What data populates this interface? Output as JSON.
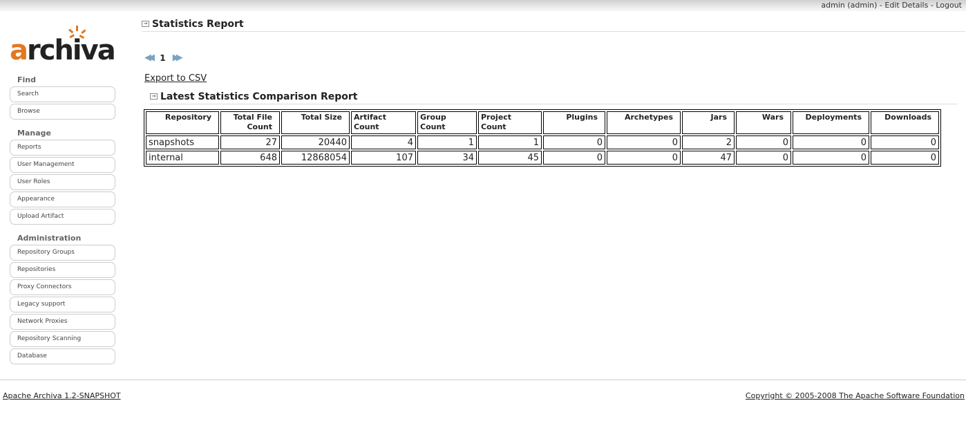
{
  "header": {
    "username": "admin",
    "role": "(admin)",
    "edit_details": "Edit Details",
    "logout": "Logout",
    "separator": "-"
  },
  "logo": {
    "first": "a",
    "rest": "rchiva"
  },
  "nav": {
    "find": {
      "heading": "Find",
      "items": [
        "Search",
        "Browse"
      ]
    },
    "manage": {
      "heading": "Manage",
      "items": [
        "Reports",
        "User Management",
        "User Roles",
        "Appearance",
        "Upload Artifact"
      ]
    },
    "admin": {
      "heading": "Administration",
      "items": [
        "Repository Groups",
        "Repositories",
        "Proxy Connectors",
        "Legacy support",
        "Network Proxies",
        "Repository Scanning",
        "Database"
      ]
    }
  },
  "main": {
    "title": "Statistics Report",
    "page_number": "1",
    "export_label": "Export to CSV",
    "comparison_title": "Latest Statistics Comparison Report"
  },
  "table": {
    "headers": [
      "Repository",
      "Total File Count",
      "Total Size",
      "Artifact Count",
      "Group Count",
      "Project Count",
      "Plugins",
      "Archetypes",
      "Jars",
      "Wars",
      "Deployments",
      "Downloads"
    ],
    "rows": [
      [
        "snapshots",
        "27",
        "20440",
        "4",
        "1",
        "1",
        "0",
        "0",
        "2",
        "0",
        "0",
        "0"
      ],
      [
        "internal",
        "648",
        "12868054",
        "107",
        "34",
        "45",
        "0",
        "0",
        "47",
        "0",
        "0",
        "0"
      ]
    ]
  },
  "footer": {
    "version": "Apache Archiva 1.2-SNAPSHOT",
    "copyright": "Copyright © 2005-2008 The Apache Software Foundation"
  },
  "colors": {
    "accent": "#e2781f",
    "pager_arrow": "#7aa3c2"
  }
}
